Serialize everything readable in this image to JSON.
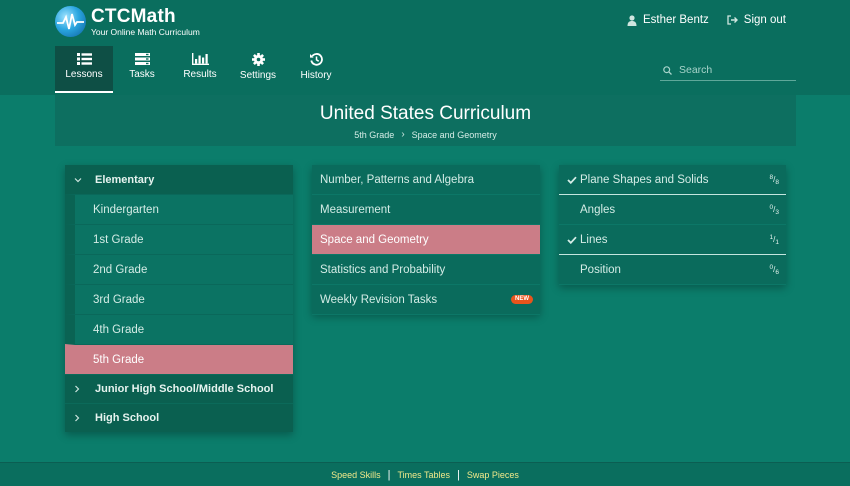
{
  "brand": {
    "name": "CTCMath",
    "tagline": "Your Online Math Curriculum"
  },
  "user": {
    "name": "Esther Bentz",
    "signout_label": "Sign out"
  },
  "nav": {
    "items": [
      {
        "label": "Lessons",
        "icon": "list-icon",
        "active": true
      },
      {
        "label": "Tasks",
        "icon": "tasks-icon"
      },
      {
        "label": "Results",
        "icon": "bar-chart-icon"
      },
      {
        "label": "Settings",
        "icon": "gear-icon"
      },
      {
        "label": "History",
        "icon": "history-icon"
      }
    ]
  },
  "search": {
    "placeholder": "Search"
  },
  "banner": {
    "title": "United States Curriculum",
    "breadcrumb": [
      "5th Grade",
      "Space and Geometry"
    ]
  },
  "left_panel": {
    "section": "Elementary",
    "grades": [
      "Kindergarten",
      "1st Grade",
      "2nd Grade",
      "3rd Grade",
      "4th Grade",
      "5th Grade"
    ],
    "selected_grade": "5th Grade",
    "other_sections": [
      "Junior High School/Middle School",
      "High School"
    ]
  },
  "topics": [
    {
      "label": "Number, Patterns and Algebra"
    },
    {
      "label": "Measurement"
    },
    {
      "label": "Space and Geometry",
      "selected": true
    },
    {
      "label": "Statistics and Probability"
    },
    {
      "label": "Weekly Revision Tasks",
      "badge": "NEW"
    }
  ],
  "lessons": [
    {
      "label": "Plane Shapes and Solids",
      "done": "8",
      "total": "8",
      "complete": true
    },
    {
      "label": "Angles",
      "done": "0",
      "total": "3",
      "complete": false
    },
    {
      "label": "Lines",
      "done": "1",
      "total": "1",
      "complete": true
    },
    {
      "label": "Position",
      "done": "0",
      "total": "6",
      "complete": false
    }
  ],
  "footer": {
    "links": [
      "Speed Skills",
      "Times Tables",
      "Swap Pieces"
    ]
  },
  "colors": {
    "background": "#0b7d6b",
    "selected": "#cb7d87",
    "badge": "#e8541c",
    "footer_link": "#f1e98a"
  }
}
